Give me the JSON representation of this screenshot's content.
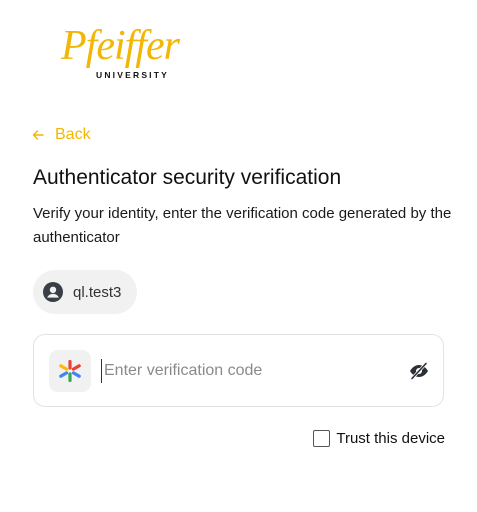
{
  "logo": {
    "wordmark": "Pfeiffer",
    "subtitle": "UNIVERSITY",
    "color": "#F2B705"
  },
  "back_link": {
    "label": "Back",
    "icon": "arrow-left-icon"
  },
  "title": "Authenticator security verification",
  "description": "Verify your identity, enter the verification code generated by the authenticator",
  "user": {
    "icon": "user-avatar-icon",
    "username": "ql.test3"
  },
  "code_field": {
    "icon": "authenticator-app-icon",
    "placeholder": "Enter verification code",
    "value": "",
    "toggle_icon": "eye-hidden-icon"
  },
  "trust_device": {
    "label": "Trust this device",
    "checked": false
  },
  "colors": {
    "accent": "#F2B705",
    "chip_bg": "#f1f1f2",
    "border": "#e3e3e6"
  }
}
